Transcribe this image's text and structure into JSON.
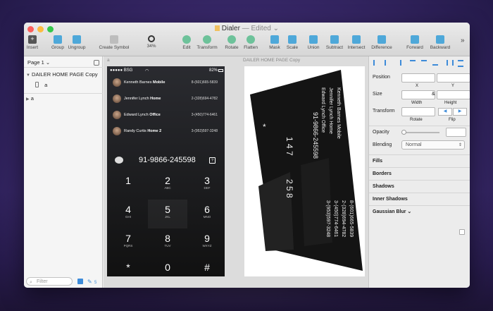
{
  "window": {
    "title": "Dialer",
    "status": "— Edited ⌄"
  },
  "toolbar": [
    {
      "label": "Insert",
      "icon": "insert-icon"
    },
    {
      "label": "Group",
      "icon": "group-icon"
    },
    {
      "label": "Ungroup",
      "icon": "ungroup-icon"
    },
    {
      "label": "Create Symbol",
      "icon": "symbol-icon"
    },
    {
      "label": "34%",
      "icon": "zoom-icon"
    },
    {
      "label": "Edit",
      "icon": "edit-icon"
    },
    {
      "label": "Transform",
      "icon": "transform-icon"
    },
    {
      "label": "Rotate",
      "icon": "rotate-icon"
    },
    {
      "label": "Flatten",
      "icon": "flatten-icon"
    },
    {
      "label": "Mask",
      "icon": "mask-icon"
    },
    {
      "label": "Scale",
      "icon": "scale-icon"
    },
    {
      "label": "Union",
      "icon": "union-icon"
    },
    {
      "label": "Subtract",
      "icon": "subtract-icon"
    },
    {
      "label": "Intersect",
      "icon": "intersect-icon"
    },
    {
      "label": "Difference",
      "icon": "difference-icon"
    },
    {
      "label": "Forward",
      "icon": "forward-icon"
    },
    {
      "label": "Backward",
      "icon": "backward-icon"
    }
  ],
  "layers": {
    "page": "Page 1 ⌄",
    "items": [
      "DAILER HOME PAGE Copy",
      "a",
      "a"
    ],
    "filter_placeholder": "Filter",
    "count": "5"
  },
  "canvas": {
    "label1": "a",
    "label2": "DAILER HOME PAGE Copy"
  },
  "phone": {
    "carrier": "●●●●● BSG",
    "battery": "82%",
    "contacts": [
      {
        "name": "Kenneth Barnes",
        "type": "Mobile",
        "phone": "8-(601)665-5839"
      },
      {
        "name": "Jennifer Lynch",
        "type": "Home",
        "phone": "2-(328)694-4782"
      },
      {
        "name": "Edward Lynch",
        "type": "Office",
        "phone": "3-(450)774-6461"
      },
      {
        "name": "Randy Curtis",
        "type": "Home 2",
        "phone": "3-(953)597-3248"
      }
    ],
    "number": "91-9866-245598",
    "keys": [
      {
        "d": "1",
        "l": ""
      },
      {
        "d": "2",
        "l": "ABC"
      },
      {
        "d": "3",
        "l": "DEF"
      },
      {
        "d": "4",
        "l": "GHI"
      },
      {
        "d": "5",
        "l": "JKL"
      },
      {
        "d": "6",
        "l": "MNO"
      },
      {
        "d": "7",
        "l": "PQRS"
      },
      {
        "d": "8",
        "l": "TUV"
      },
      {
        "d": "9",
        "l": "WXYZ"
      },
      {
        "d": "*",
        "l": ""
      },
      {
        "d": "0",
        "l": ""
      },
      {
        "d": "#",
        "l": ""
      }
    ]
  },
  "inspector": {
    "position": "Position",
    "x": "X",
    "y": "Y",
    "size": "Size",
    "width": "Width",
    "height": "Height",
    "transform": "Transform",
    "rotate": "Rotate",
    "flip": "Flip",
    "opacity": "Opacity",
    "blending": "Blending",
    "blend_value": "Normal",
    "sections": [
      "Fills",
      "Borders",
      "Shadows",
      "Inner Shadows",
      "Gaussian Blur ⌄"
    ]
  }
}
